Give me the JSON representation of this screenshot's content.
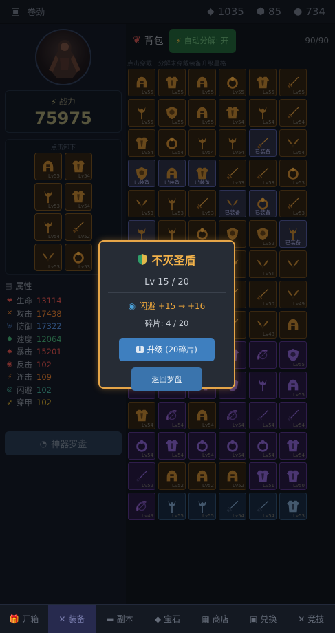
{
  "topbar": {
    "user_name": "卷劲",
    "diamonds": "1035",
    "gems": "85",
    "gold": "734"
  },
  "hero": {
    "power_label": "战力",
    "power_value": "75975",
    "equip_title": "点击卸下",
    "slots": [
      "Lv55",
      "Lv54",
      "Lv53",
      "Lv54",
      "Lv54",
      "Lv52",
      "Lv53",
      "Lv53"
    ]
  },
  "attributes": {
    "title": "属性",
    "rows": [
      {
        "icon": "heart-icon",
        "glyph": "❤",
        "name": "生命",
        "value": "13114",
        "color": "#c84b48"
      },
      {
        "icon": "swords-icon",
        "glyph": "✕",
        "name": "攻击",
        "value": "17438",
        "color": "#c8702c"
      },
      {
        "icon": "shield-icon",
        "glyph": "⛨",
        "name": "防御",
        "value": "17322",
        "color": "#4a7bc0"
      },
      {
        "icon": "boot-icon",
        "glyph": "◆",
        "name": "速度",
        "value": "12064",
        "color": "#3e9b6a"
      },
      {
        "icon": "crit-icon",
        "glyph": "✸",
        "name": "暴击",
        "value": "15201",
        "color": "#c84b48"
      },
      {
        "icon": "counter-icon",
        "glyph": "◉",
        "name": "反击",
        "value": "102",
        "color": "#c84b48"
      },
      {
        "icon": "combo-icon",
        "glyph": "⚡",
        "name": "连击",
        "value": "109",
        "color": "#c8702c"
      },
      {
        "icon": "dodge-icon",
        "glyph": "◎",
        "name": "闪避",
        "value": "102",
        "color": "#3e9b8a"
      },
      {
        "icon": "pierce-icon",
        "glyph": "➶",
        "name": "穿甲",
        "value": "102",
        "color": "#c8a02c"
      }
    ]
  },
  "compass_button": "神器罗盘",
  "bag": {
    "title": "背包",
    "auto_btn": "自动分解: 开",
    "count": "90/90",
    "hint": "点击穿戴 | 分解未穿戴装备升级星格",
    "cells": [
      {
        "t": "gold",
        "g": "helm",
        "lv": "Lv55"
      },
      {
        "t": "gold",
        "g": "armor",
        "lv": "Lv55"
      },
      {
        "t": "gold",
        "g": "helm",
        "lv": "Lv55"
      },
      {
        "t": "gold",
        "g": "ring",
        "lv": "Lv55"
      },
      {
        "t": "gold",
        "g": "armor",
        "lv": "Lv55"
      },
      {
        "t": "gold",
        "g": "sword",
        "lv": "Lv55"
      },
      {
        "t": "gold",
        "g": "staff",
        "lv": "Lv55"
      },
      {
        "t": "gold",
        "g": "shield",
        "lv": "Lv55"
      },
      {
        "t": "gold",
        "g": "helm",
        "lv": "Lv55"
      },
      {
        "t": "gold",
        "g": "armor",
        "lv": "Lv54"
      },
      {
        "t": "gold",
        "g": "staff",
        "lv": "Lv54"
      },
      {
        "t": "gold",
        "g": "sword",
        "lv": "Lv54"
      },
      {
        "t": "gold",
        "g": "armor",
        "lv": "Lv54"
      },
      {
        "t": "gold",
        "g": "ring",
        "lv": "Lv54"
      },
      {
        "t": "gold",
        "g": "staff",
        "lv": "Lv54"
      },
      {
        "t": "gold",
        "g": "staff",
        "lv": "Lv54"
      },
      {
        "t": "equipped",
        "g": "sword",
        "tag": "已装备"
      },
      {
        "t": "gold",
        "g": "wing",
        "lv": "Lv54"
      },
      {
        "t": "equipped",
        "g": "shield",
        "tag": "已装备"
      },
      {
        "t": "equipped",
        "g": "helm",
        "tag": "已装备"
      },
      {
        "t": "equipped",
        "g": "armor",
        "tag": "已装备"
      },
      {
        "t": "gold",
        "g": "sword",
        "lv": "Lv53"
      },
      {
        "t": "gold",
        "g": "sword",
        "lv": "Lv53"
      },
      {
        "t": "gold",
        "g": "ring",
        "lv": "Lv53"
      },
      {
        "t": "gold",
        "g": "wing",
        "lv": "Lv53"
      },
      {
        "t": "gold",
        "g": "staff",
        "lv": "Lv53"
      },
      {
        "t": "gold",
        "g": "sword",
        "lv": "Lv53"
      },
      {
        "t": "equipped",
        "g": "wing",
        "tag": "已装备"
      },
      {
        "t": "equipped",
        "g": "ring",
        "tag": "已装备"
      },
      {
        "t": "gold",
        "g": "sword",
        "lv": "Lv53"
      },
      {
        "t": "equipped",
        "g": "staff",
        "tag": "已装备"
      },
      {
        "t": "gold",
        "g": "staff",
        "lv": ""
      },
      {
        "t": "gold",
        "g": "ring",
        "lv": ""
      },
      {
        "t": "gold",
        "g": "shield",
        "lv": ""
      },
      {
        "t": "gold",
        "g": "shield",
        "lv": "Lv52"
      },
      {
        "t": "equipped",
        "g": "staff",
        "tag": "已装备"
      },
      {
        "t": "gold",
        "g": "wing",
        "lv": ""
      },
      {
        "t": "gold",
        "g": "shield",
        "lv": ""
      },
      {
        "t": "gold",
        "g": "armor",
        "lv": ""
      },
      {
        "t": "gold",
        "g": "wing",
        "lv": ""
      },
      {
        "t": "gold",
        "g": "wing",
        "lv": "Lv51"
      },
      {
        "t": "gold",
        "g": "wing",
        "lv": ""
      },
      {
        "t": "gold",
        "g": "helm",
        "lv": ""
      },
      {
        "t": "gold",
        "g": "armor",
        "lv": ""
      },
      {
        "t": "gold",
        "g": "shield",
        "lv": ""
      },
      {
        "t": "gold",
        "g": "sword",
        "lv": ""
      },
      {
        "t": "gold",
        "g": "sword",
        "lv": "Lv50"
      },
      {
        "t": "gold",
        "g": "wing",
        "lv": "Lv49"
      },
      {
        "t": "gold",
        "g": "shield",
        "lv": ""
      },
      {
        "t": "gold",
        "g": "armor",
        "lv": ""
      },
      {
        "t": "gold",
        "g": "staff",
        "lv": ""
      },
      {
        "t": "gold",
        "g": "sword",
        "lv": ""
      },
      {
        "t": "gold",
        "g": "wing",
        "lv": "Lv48"
      },
      {
        "t": "gold",
        "g": "helm",
        "lv": ""
      },
      {
        "t": "purple",
        "g": "armor",
        "lv": ""
      },
      {
        "t": "purple",
        "g": "armor",
        "lv": ""
      },
      {
        "t": "purple",
        "g": "armor",
        "lv": ""
      },
      {
        "t": "purple",
        "g": "armor",
        "lv": ""
      },
      {
        "t": "purple",
        "g": "bow",
        "lv": ""
      },
      {
        "t": "purple",
        "g": "shield",
        "lv": "Lv55"
      },
      {
        "t": "purple",
        "g": "helm",
        "lv": ""
      },
      {
        "t": "purple",
        "g": "wing",
        "lv": ""
      },
      {
        "t": "purple",
        "g": "helm",
        "lv": ""
      },
      {
        "t": "purple",
        "g": "shield",
        "lv": ""
      },
      {
        "t": "purple",
        "g": "staff",
        "lv": ""
      },
      {
        "t": "purple",
        "g": "helm",
        "lv": "Lv55"
      },
      {
        "t": "gold",
        "g": "armor",
        "lv": "Lv54"
      },
      {
        "t": "purple",
        "g": "bow",
        "lv": "Lv54"
      },
      {
        "t": "gold",
        "g": "helm",
        "lv": "Lv54"
      },
      {
        "t": "purple",
        "g": "bow",
        "lv": "Lv54"
      },
      {
        "t": "purple",
        "g": "sword",
        "lv": "Lv54"
      },
      {
        "t": "purple",
        "g": "sword",
        "lv": "Lv54"
      },
      {
        "t": "purple",
        "g": "ring",
        "lv": "Lv54"
      },
      {
        "t": "purple",
        "g": "armor",
        "lv": "Lv54"
      },
      {
        "t": "purple",
        "g": "ring",
        "lv": "Lv54"
      },
      {
        "t": "purple",
        "g": "ring",
        "lv": "Lv54"
      },
      {
        "t": "purple",
        "g": "ring",
        "lv": "Lv54"
      },
      {
        "t": "purple",
        "g": "armor",
        "lv": "Lv54"
      },
      {
        "t": "purple",
        "g": "sword",
        "lv": "Lv52"
      },
      {
        "t": "gold",
        "g": "helm",
        "lv": "Lv52"
      },
      {
        "t": "gold",
        "g": "helm",
        "lv": "Lv52"
      },
      {
        "t": "gold",
        "g": "helm",
        "lv": "Lv52"
      },
      {
        "t": "purple",
        "g": "armor",
        "lv": "Lv51"
      },
      {
        "t": "purple",
        "g": "armor",
        "lv": "Lv50"
      },
      {
        "t": "purple",
        "g": "bow",
        "lv": "Lv49"
      },
      {
        "t": "blue",
        "g": "staff",
        "lv": "Lv55"
      },
      {
        "t": "blue",
        "g": "staff",
        "lv": "Lv55"
      },
      {
        "t": "blue",
        "g": "sword",
        "lv": "Lv54"
      },
      {
        "t": "blue",
        "g": "sword",
        "lv": "Lv54"
      },
      {
        "t": "blue",
        "g": "armor",
        "lv": "Lv53"
      }
    ]
  },
  "modal": {
    "title": "不灭圣盾",
    "level": "Lv 15 / 20",
    "stat": "闪避 +15 → +16",
    "fragments": "碎片: 4 / 20",
    "upgrade_btn": "升级 (20碎片)",
    "back_btn": "返回罗盘"
  },
  "tabs": [
    {
      "label": "开箱",
      "icon": "gift-icon",
      "glyph": "🎁",
      "active": false
    },
    {
      "label": "装备",
      "icon": "swords-icon",
      "glyph": "✕",
      "active": true
    },
    {
      "label": "副本",
      "icon": "dungeon-icon",
      "glyph": "▬",
      "active": false
    },
    {
      "label": "宝石",
      "icon": "gem-icon",
      "glyph": "◆",
      "active": false
    },
    {
      "label": "商店",
      "icon": "shop-icon",
      "glyph": "▦",
      "active": false
    },
    {
      "label": "兑换",
      "icon": "exchange-icon",
      "glyph": "▣",
      "active": false
    },
    {
      "label": "竞技",
      "icon": "arena-icon",
      "glyph": "✕",
      "active": false
    }
  ]
}
